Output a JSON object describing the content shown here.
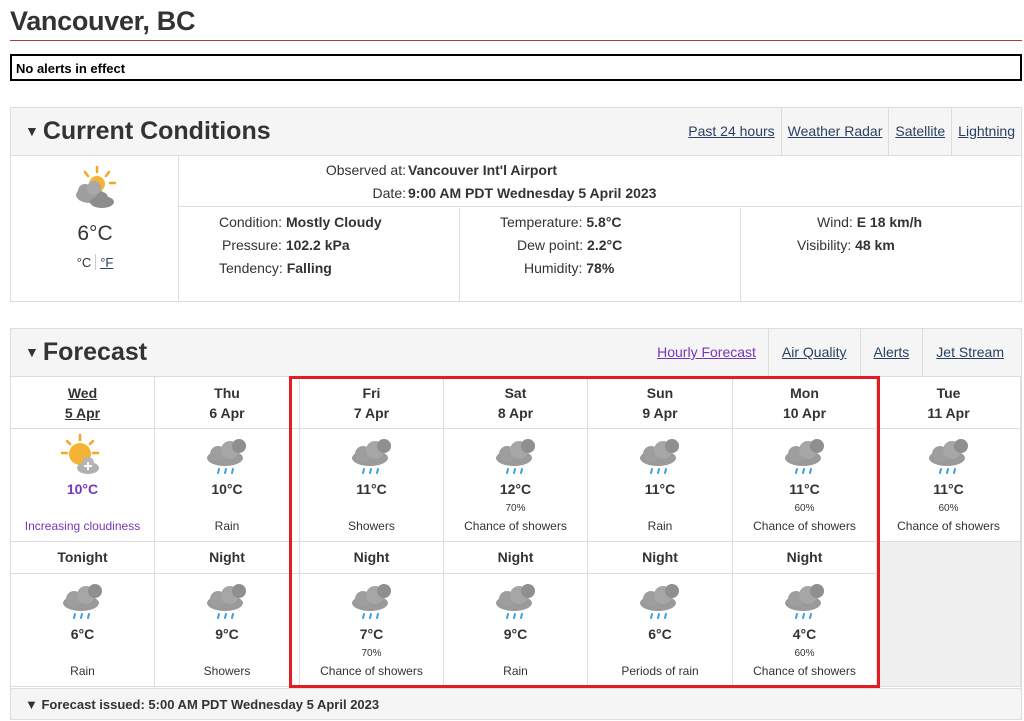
{
  "page": {
    "title": "Vancouver, BC",
    "alert": "No alerts in effect"
  },
  "current": {
    "heading": "Current Conditions",
    "links": [
      "Past 24 hours",
      "Weather Radar",
      "Satellite",
      "Lightning"
    ],
    "temp": "6°C",
    "unit_c": "°C",
    "unit_f": "°F",
    "observed_label": "Observed at:",
    "observed_value": "Vancouver Int'l Airport",
    "date_label": "Date:",
    "date_value": "9:00 AM PDT Wednesday 5 April 2023",
    "condition_label": "Condition:",
    "condition_value": "Mostly Cloudy",
    "pressure_label": "Pressure:",
    "pressure_value": "102.2 kPa",
    "tendency_label": "Tendency:",
    "tendency_value": "Falling",
    "temperature_label": "Temperature:",
    "temperature_value": "5.8°C",
    "dewpoint_label": "Dew point:",
    "dewpoint_value": "2.2°C",
    "humidity_label": "Humidity:",
    "humidity_value": "78%",
    "wind_label": "Wind:",
    "wind_value": "E 18 km/h",
    "visibility_label": "Visibility:",
    "visibility_value": "48 km"
  },
  "forecast": {
    "heading": "Forecast",
    "links": [
      "Hourly Forecast",
      "Air Quality",
      "Alerts",
      "Jet Stream"
    ],
    "days": [
      {
        "name": "Wed",
        "date": "5 Apr",
        "temp": "10°C",
        "pop": "",
        "summary": "Increasing cloudiness",
        "icon": "sun-cloud-icon"
      },
      {
        "name": "Thu",
        "date": "6 Apr",
        "temp": "10°C",
        "pop": "",
        "summary": "Rain",
        "icon": "rain-icon"
      },
      {
        "name": "Fri",
        "date": "7 Apr",
        "temp": "11°C",
        "pop": "",
        "summary": "Showers",
        "icon": "rain-icon"
      },
      {
        "name": "Sat",
        "date": "8 Apr",
        "temp": "12°C",
        "pop": "70%",
        "summary": "Chance of showers",
        "icon": "rain-icon"
      },
      {
        "name": "Sun",
        "date": "9 Apr",
        "temp": "11°C",
        "pop": "",
        "summary": "Rain",
        "icon": "rain-icon"
      },
      {
        "name": "Mon",
        "date": "10 Apr",
        "temp": "11°C",
        "pop": "60%",
        "summary": "Chance of showers",
        "icon": "rain-icon"
      },
      {
        "name": "Tue",
        "date": "11 Apr",
        "temp": "11°C",
        "pop": "60%",
        "summary": "Chance of showers",
        "icon": "rain-icon"
      }
    ],
    "nights": [
      {
        "name": "Tonight",
        "temp": "6°C",
        "pop": "",
        "summary": "Rain"
      },
      {
        "name": "Night",
        "temp": "9°C",
        "pop": "",
        "summary": "Showers"
      },
      {
        "name": "Night",
        "temp": "7°C",
        "pop": "70%",
        "summary": "Chance of showers"
      },
      {
        "name": "Night",
        "temp": "9°C",
        "pop": "",
        "summary": "Rain"
      },
      {
        "name": "Night",
        "temp": "6°C",
        "pop": "",
        "summary": "Periods of rain"
      },
      {
        "name": "Night",
        "temp": "4°C",
        "pop": "60%",
        "summary": "Chance of showers"
      }
    ],
    "issued": "Forecast issued: 5:00 AM PDT Wednesday 5 April 2023"
  },
  "colors": {
    "accent_rule": "#af3c43",
    "link": "#284162",
    "visited": "#7834bc",
    "highlight": "#e31b23"
  }
}
